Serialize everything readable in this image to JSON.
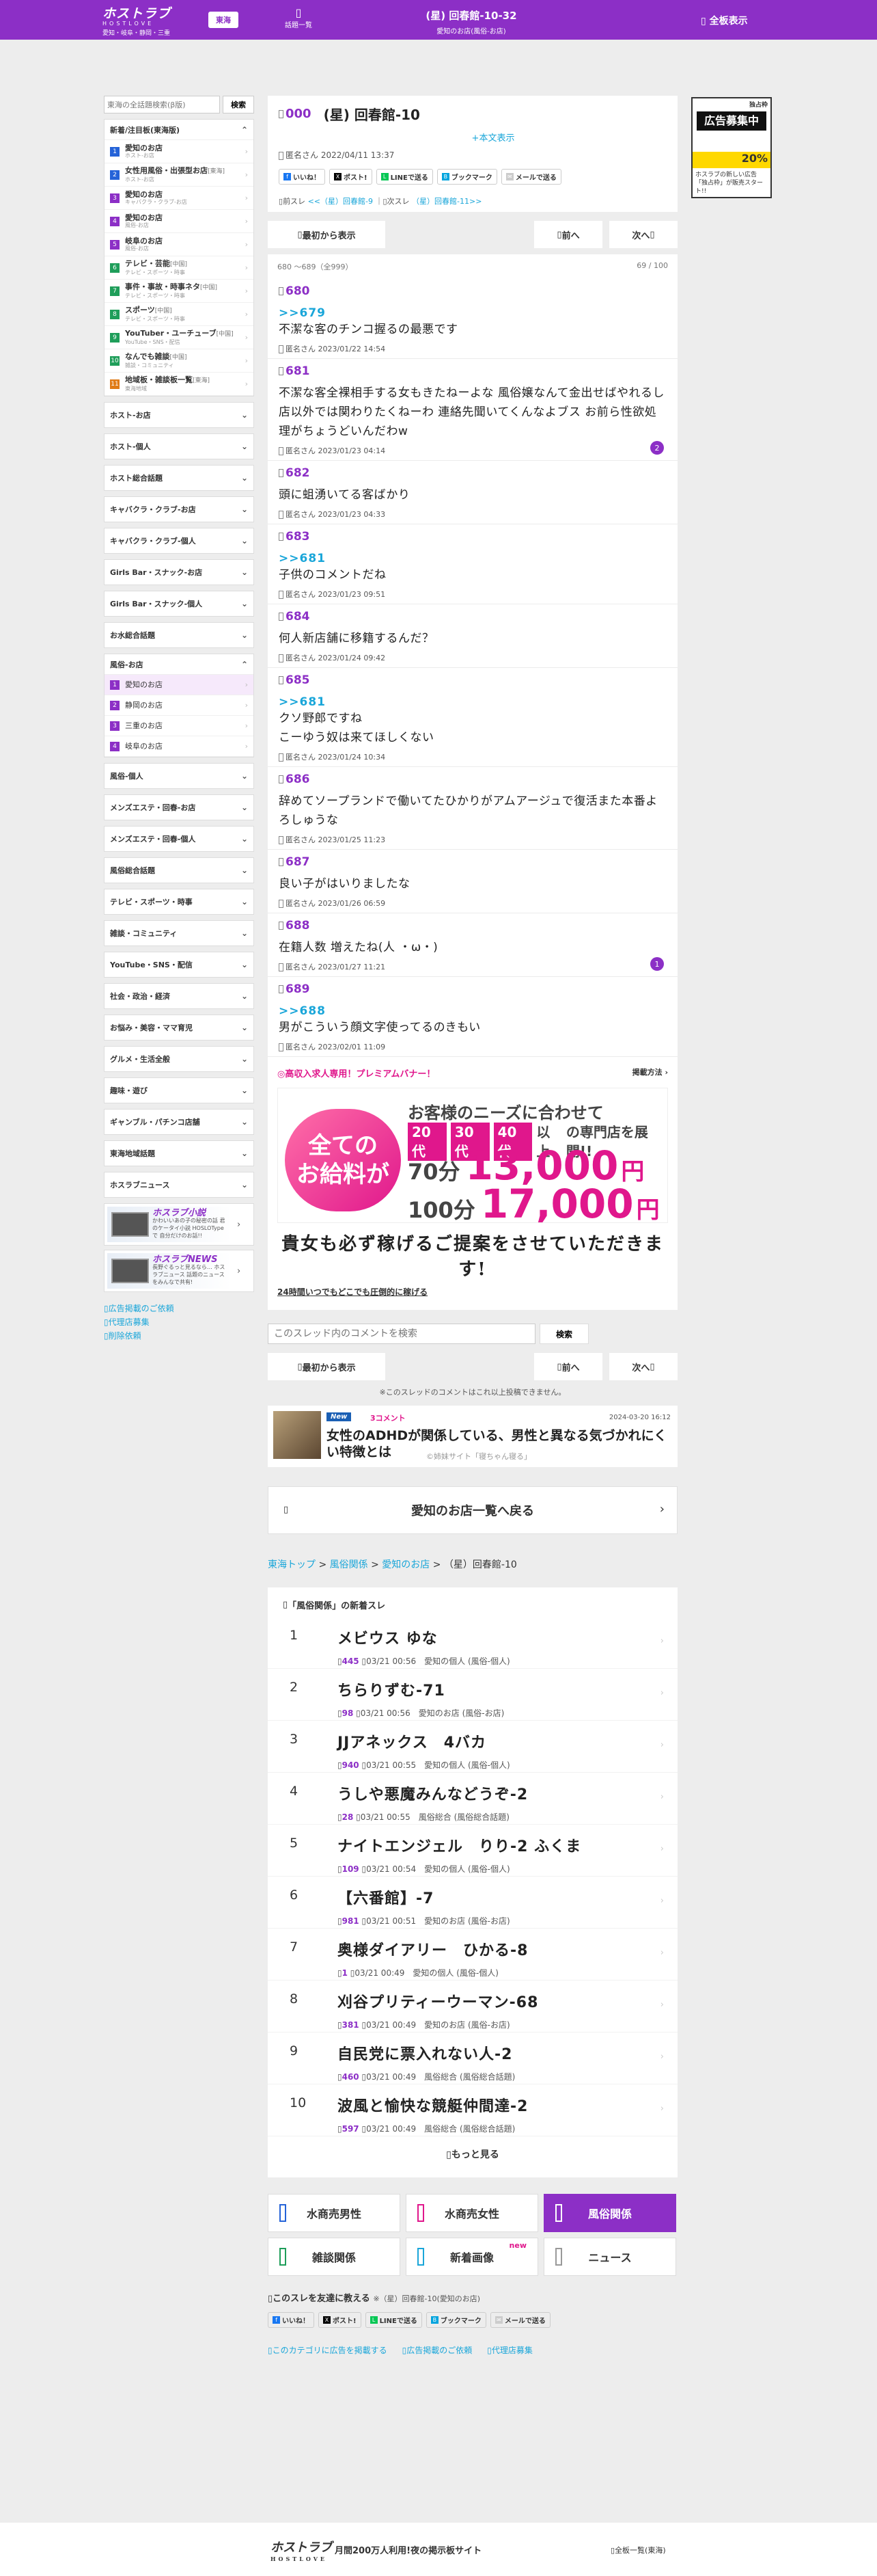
{
  "header": {
    "logo": "ホストラブ",
    "logo_sub": "HOSTLOVE",
    "area_sub": "愛知・岐阜・静岡・三重",
    "region": "東海",
    "board": "話題一覧",
    "thread_title": "(星) 回春館-10-32",
    "thread_sub": "愛知のお店(風俗-お店)",
    "menu": "全板表示"
  },
  "sidebar": {
    "search_placeholder": "東海の全話題検索(β版)",
    "search_button": "検索",
    "open_category": "新着/注目板(東海版)",
    "items": [
      {
        "n": "1",
        "color": "#2563d8",
        "label": "愛知のお店",
        "sub": "ホスト-お店"
      },
      {
        "n": "2",
        "color": "#2563d8",
        "label": "女性用風俗・出張型お店",
        "tag": "[東海]",
        "sub": "ホスト-お店"
      },
      {
        "n": "3",
        "color": "#8c2fc6",
        "label": "愛知のお店",
        "sub": "キャバクラ・クラブ-お店"
      },
      {
        "n": "4",
        "color": "#8c2fc6",
        "label": "愛知のお店",
        "sub": "風俗-お店"
      },
      {
        "n": "5",
        "color": "#8c2fc6",
        "label": "岐阜のお店",
        "sub": "風俗-お店"
      },
      {
        "n": "6",
        "color": "#1f9e5a",
        "label": "テレビ・芸能",
        "tag": "[中国]",
        "sub": "テレビ・スポーツ・時事"
      },
      {
        "n": "7",
        "color": "#1f9e5a",
        "label": "事件・事故・時事ネタ",
        "tag": "[中国]",
        "sub": "テレビ・スポーツ・時事"
      },
      {
        "n": "8",
        "color": "#1f9e5a",
        "label": "スポーツ",
        "tag": "[中国]",
        "sub": "テレビ・スポーツ・時事"
      },
      {
        "n": "9",
        "color": "#1f9e5a",
        "label": "YouTuber・ユーチューブ",
        "tag": "[中国]",
        "sub": "YouTube・SNS・配信"
      },
      {
        "n": "10",
        "color": "#1f9e5a",
        "label": "なんでも雑談",
        "tag": "[中国]",
        "sub": "雑談・コミュニティ"
      },
      {
        "n": "11",
        "color": "#e07b17",
        "label": "地域板・雑談板一覧",
        "tag": "[東海]",
        "sub": "東海地域"
      }
    ],
    "cats_a": [
      "ホスト-お店",
      "ホスト-個人",
      "ホスト総合話題",
      "キャバクラ・クラブ-お店",
      "キャバクラ・クラブ-個人",
      "Girls Bar・スナック-お店",
      "Girls Bar・スナック-個人",
      "お水総合話題"
    ],
    "fuzoku_label": "風俗-お店",
    "fuzoku_items": [
      {
        "n": "1",
        "label": "愛知のお店",
        "active": true
      },
      {
        "n": "2",
        "label": "静岡のお店"
      },
      {
        "n": "3",
        "label": "三重のお店"
      },
      {
        "n": "4",
        "label": "岐阜のお店"
      }
    ],
    "cats_b": [
      "風俗-個人",
      "メンズエステ・回春-お店",
      "メンズエステ・回春-個人",
      "風俗総合話題",
      "テレビ・スポーツ・時事",
      "雑談・コミュニティ",
      "YouTube・SNS・配信",
      "社会・政治・経済",
      "お悩み・美容・ママ育児",
      "グルメ・生活全般",
      "趣味・遊び",
      "ギャンブル・パチンコ店舗",
      "東海地域話題",
      "ホスラブニュース"
    ],
    "ad1_title": "ホスラブ小説",
    "ad1_text": "かわいいあの子の秘密の話 君のケータイ小説 HOSLOTypeで 自分だけのお話!!",
    "ad2_title": "ホスラブNEWS",
    "ad2_text": "長野ぐるっと見るなら… ホスラブニュース 話題のニュースをみんなで共有!",
    "links": [
      "広告掲載のご依頼",
      "代理店募集",
      "削除依頼"
    ]
  },
  "thread": {
    "no": "000",
    "title": "(星) 回春館-10",
    "original": "+本文表示",
    "meta": "匿名さん 2022/04/11 13:37",
    "share": [
      "いいね！",
      "ポスト!",
      "LINEで送る",
      "ブックマーク",
      "メールで送る"
    ],
    "prev_label": "前スレ",
    "prev_link": "<<（星）回春館-9",
    "next_label": "次スレ",
    "next_link": "（星）回春館-11>>"
  },
  "nav": {
    "first": "最初から表示",
    "prev": "前へ",
    "next": "次へ"
  },
  "posts_range": "680 〜689（全999）",
  "posts_page": "69 / 100",
  "posts": [
    {
      "no": "680",
      "anchor": ">>679",
      "body": "不潔な客のチンコ握るの最悪です",
      "meta": "匿名さん 2023/01/22 14:54"
    },
    {
      "no": "681",
      "anchor": "",
      "body": "不潔な客全裸相手する女もきたねーよな 風俗嬢なんて金出せばやれるし店以外では関わりたくねーわ 連絡先聞いてくんなよブス お前ら性欲処理がちょうどいんだわw",
      "meta": "匿名さん 2023/01/23 04:14",
      "badge": "2"
    },
    {
      "no": "682",
      "anchor": "",
      "body": "頭に蛆湧いてる客ばかり",
      "meta": "匿名さん 2023/01/23 04:33"
    },
    {
      "no": "683",
      "anchor": ">>681",
      "body": "子供のコメントだね",
      "meta": "匿名さん 2023/01/23 09:51"
    },
    {
      "no": "684",
      "anchor": "",
      "body": "何人新店舗に移籍するんだ？",
      "meta": "匿名さん 2023/01/24 09:42"
    },
    {
      "no": "685",
      "anchor": ">>681",
      "body": "クソ野郎ですね\nこーゆう奴は来てほしくない",
      "meta": "匿名さん 2023/01/24 10:34"
    },
    {
      "no": "686",
      "anchor": "",
      "body": "辞めてソープランドで働いてたひかりがアムアージュで復活また本番よろしゅうな",
      "meta": "匿名さん 2023/01/25 11:23"
    },
    {
      "no": "687",
      "anchor": "",
      "body": "良い子がはいりましたな",
      "meta": "匿名さん 2023/01/26 06:59"
    },
    {
      "no": "688",
      "anchor": "",
      "body": "在籍人数 増えたね(人 ・ω・)",
      "meta": "匿名さん 2023/01/27 11:21",
      "badge": "1"
    },
    {
      "no": "689",
      "anchor": ">>688",
      "body": "男がこういう顔文字使ってるのきもい",
      "meta": "匿名さん 2023/02/01 11:09"
    }
  ],
  "premium": {
    "head": "◎高収入求人専用！プレミアムバナー！",
    "method": "掲載方法 ›",
    "circle": "全ての\nお給料が",
    "h1": "お客様のニーズに合わせて",
    "tag1": "20代",
    "tag2": "30代",
    "tag3": "40代",
    "tag3_sub": "以上",
    "tag_tail": "の専門店を展開!!",
    "pay1_h": "70分",
    "pay1_v": "13,000",
    "pay1_u": "円",
    "pay2_h": "100分",
    "pay2_v": "17,000",
    "pay2_u": "円",
    "catch": "貴女も必ず稼げるご提案をさせていただきます!",
    "link": "24時間いつでもどこでも圧倒的に稼げる"
  },
  "comment_search": {
    "placeholder": "このスレッド内のコメントを検索",
    "button": "検索"
  },
  "finish": "※このスレッドのコメントはこれ以上投稿できません。",
  "news": {
    "new": "New",
    "comments": "3コメント",
    "date": "2024-03-20 16:12",
    "title": "女性のADHDが関係している、男性と異なる気づかれにくい特徴とは",
    "source": "©姉妹サイト「寝ちゃん寝る」"
  },
  "back": "愛知のお店一覧へ戻る",
  "breadcrumb": {
    "a": "東海トップ",
    "b": "風俗関係",
    "c": "愛知のお店",
    "d": "（星）回春館-10"
  },
  "ranking": {
    "head": "「風俗関係」の新着スレ",
    "items": [
      {
        "n": "1",
        "title": "メビウス ゆな",
        "count": "445",
        "time": "03/21 00:56",
        "cat": "愛知の個人",
        "sub": "(風俗-個人)"
      },
      {
        "n": "2",
        "title": "ちらりずむ-71",
        "count": "98",
        "time": "03/21 00:56",
        "cat": "愛知のお店",
        "sub": "(風俗-お店)"
      },
      {
        "n": "3",
        "title": "JJアネックス　4バカ",
        "count": "940",
        "time": "03/21 00:55",
        "cat": "愛知の個人",
        "sub": "(風俗-個人)"
      },
      {
        "n": "4",
        "title": "うしや悪魔みんなどうぞ-2",
        "count": "28",
        "time": "03/21 00:55",
        "cat": "風俗総合",
        "sub": "(風俗総合話題)"
      },
      {
        "n": "5",
        "title": "ナイトエンジェル　りり-2 ふくま",
        "count": "109",
        "time": "03/21 00:54",
        "cat": "愛知の個人",
        "sub": "(風俗-個人)"
      },
      {
        "n": "6",
        "title": "【六番館】-7",
        "count": "981",
        "time": "03/21 00:51",
        "cat": "愛知のお店",
        "sub": "(風俗-お店)"
      },
      {
        "n": "7",
        "title": "奥様ダイアリー　ひかる-8",
        "count": "1",
        "time": "03/21 00:49",
        "cat": "愛知の個人",
        "sub": "(風俗-個人)"
      },
      {
        "n": "8",
        "title": "刈谷プリティーウーマン-68",
        "count": "381",
        "time": "03/21 00:49",
        "cat": "愛知のお店",
        "sub": "(風俗-お店)"
      },
      {
        "n": "9",
        "title": "自民党に票入れない人-2",
        "count": "460",
        "time": "03/21 00:49",
        "cat": "風俗総合",
        "sub": "(風俗総合話題)"
      },
      {
        "n": "10",
        "title": "波風と愉快な競艇仲間達-2",
        "count": "597",
        "time": "03/21 00:49",
        "cat": "風俗総合",
        "sub": "(風俗総合話題)"
      }
    ],
    "more": "もっと見る"
  },
  "categories": [
    {
      "label": "水商売男性",
      "color": "#2563d8"
    },
    {
      "label": "水商売女性",
      "color": "#e0178c"
    },
    {
      "label": "風俗関係",
      "color": "#ffffff",
      "active": true
    },
    {
      "label": "雑談関係",
      "color": "#1f9e5a"
    },
    {
      "label": "新着画像",
      "color": "#1aa6d9",
      "new": "new"
    },
    {
      "label": "ニュース",
      "color": "#999999"
    }
  ],
  "share_block": {
    "head": "このスレを友達に教える",
    "sub": "※（星）回春館-10(愛知のお店)"
  },
  "foot_links": [
    "このカテゴリに広告を掲載する",
    "広告掲載のご依頼",
    "代理店募集"
  ],
  "right_ad": {
    "top": "独占枠",
    "main": "広告募集中",
    "price": "20%",
    "desc": "ホスラブの新しい広告「独占枠」が販売スタート!!"
  },
  "footer": {
    "logo": "ホストラブ",
    "logo_sub": "HOSTLOVE",
    "catch": "月間200万人利用!夜の掲示板サイト",
    "right": "全板一覧(東海)"
  },
  "colors": {
    "brand": "#8c2fc6",
    "link": "#1aa6d9",
    "accent": "#e0178c"
  }
}
